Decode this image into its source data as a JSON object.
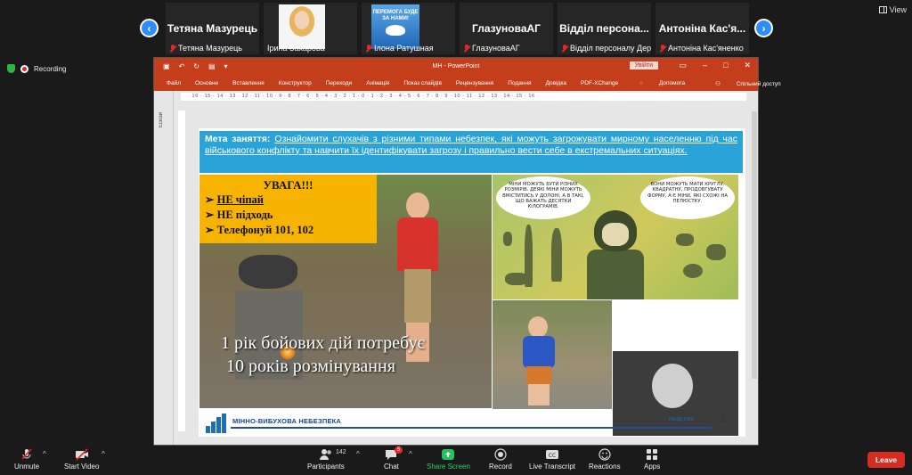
{
  "participants": [
    {
      "display": "Тетяна Мазурець",
      "label": "Тетяна Мазурець"
    },
    {
      "display": "",
      "label": "Ірина Захарова"
    },
    {
      "display": "",
      "label": "Ілона Ратушная",
      "poster_text": "ПЕРЕМОГА БУДЕ ЗА НАМИ!"
    },
    {
      "display": "ГлазуноваАГ",
      "label": "ГлазуноваАГ"
    },
    {
      "display": "Відділ персона...",
      "label": "Відділ персоналу Дер..."
    },
    {
      "display": "Антоніна Кас'я...",
      "label": "Антоніна Кас'яненко"
    }
  ],
  "header": {
    "view_label": "View",
    "recording_label": "Recording"
  },
  "ppt": {
    "title": "МН  -  PowerPoint",
    "signin": "Увійти",
    "tabs": [
      "Файл",
      "Основне",
      "Вставлення",
      "Конструктор",
      "Переходи",
      "Анімація",
      "Показ слайдів",
      "Рецензування",
      "Подання",
      "Довідка",
      "PDF-XChange"
    ],
    "help": "Допомога",
    "share": "Спільний доступ",
    "thumbs_label": "Ескізи",
    "ruler": "· 16 · 15 · 14 · 13 · 12 · 11 · 10 · 9 · 8 · 7 · 6 · 5 · 4 · 3 · 2 · 1 · 0 · 1 · 2 · 3 · 4 · 5 · 6 · 7 · 8 · 9 · 10 · 11 · 12 · 13 · 14 · 15 · 16 ·"
  },
  "slide": {
    "goal_label": "Мета заняття:",
    "goal_text": "Ознайомити слухачів з різними типами небезпек, які можуть загрожувати мирному населенню під час військового конфлікту та навчити їх ідентифікувати загрозу і правильно вести себе в екстремальних ситуаціях.",
    "warning_title": "УВАГА!!!",
    "warning_items": [
      "НЕ чіпай",
      "НЕ підходь",
      "Телефонуй 101, 102"
    ],
    "caption_line1": "1 рік бойових дій потребує",
    "caption_line2": "10 років розмінування",
    "bubble_left": "МІНИ МОЖУТЬ БУТИ РІЗНИХ РОЗМІРІВ. ДЕЯКІ МІНИ МОЖУТЬ ВМІСТИТИСЬ У ДОЛОНІ, А В ТАКІ, ЩО ВАЖАТЬ ДЕСЯТКИ КІЛОГРАМІВ.",
    "bubble_right": "ВОНИ МОЖУТЬ МАТИ КРУГЛУ, КВАДРАТНУ, ПРОДОВГУВАТУ ФОРМУ, А Є МІНИ, ЯКІ СХОЖІ НА ПЕЛЮСТКУ.",
    "footer_title": "МІННО-ВИБУХОВА НЕБЕЗПЕКА",
    "footer_url": "ntudp.com",
    "page_number": "2"
  },
  "toolbar": {
    "unmute": "Unmute",
    "start_video": "Start Video",
    "participants": "Participants",
    "participants_count": "142",
    "chat": "Chat",
    "chat_badge": "5",
    "share_screen": "Share Screen",
    "record": "Record",
    "live_transcript": "Live Transcript",
    "reactions": "Reactions",
    "apps": "Apps",
    "leave": "Leave"
  },
  "colors": {
    "accent": "#2d8cff",
    "ppt_red": "#c43e1c",
    "goal_blue": "#2aa3d8",
    "warning_yellow": "#f6b400",
    "leave": "#d52d21"
  }
}
